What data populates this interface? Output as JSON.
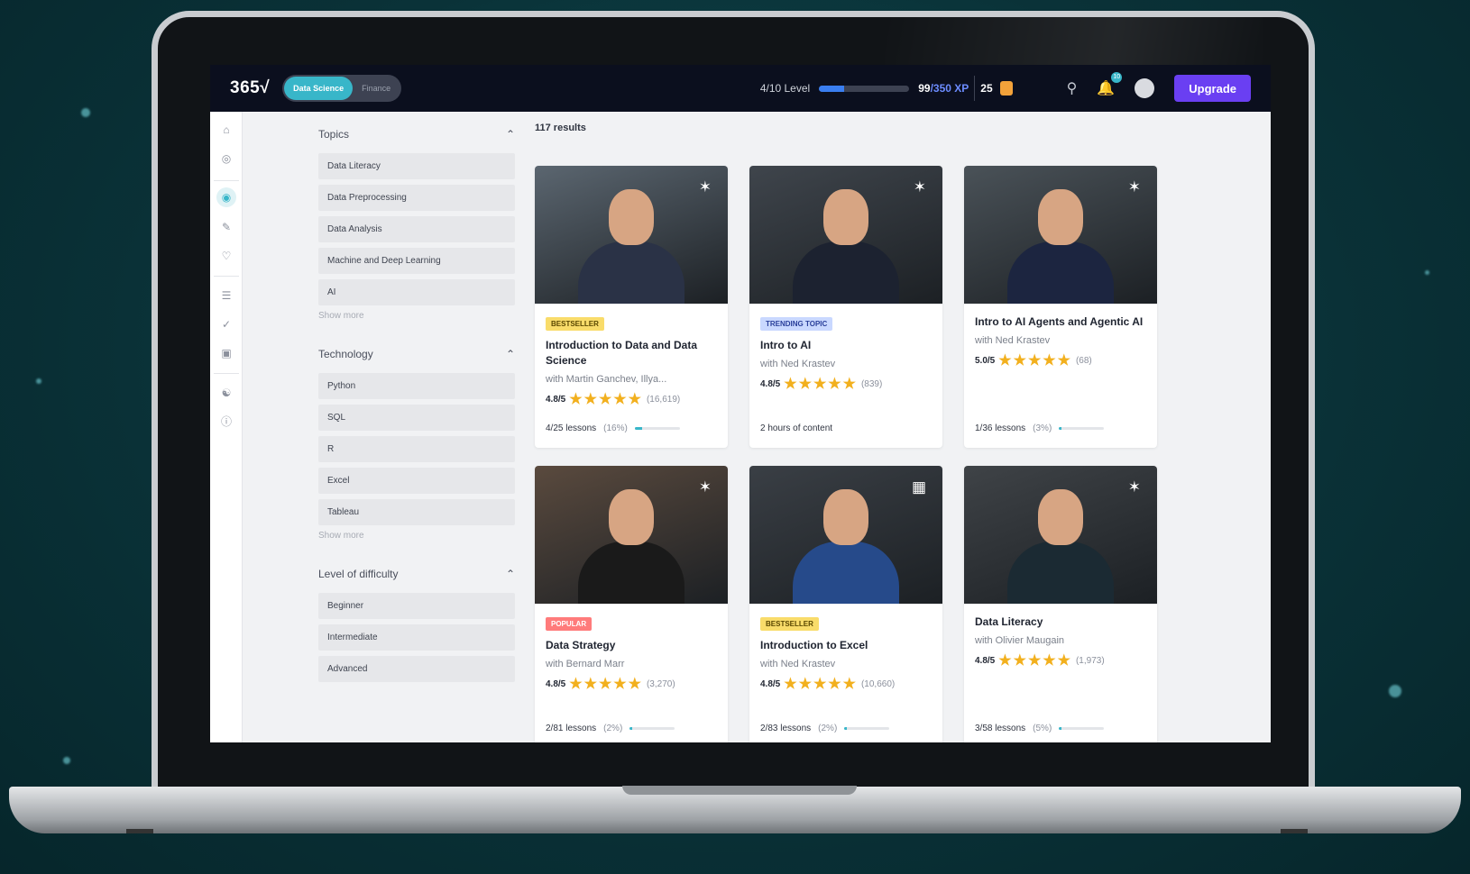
{
  "topbar": {
    "logo": "365√",
    "segments": [
      "Data Science",
      "Finance"
    ],
    "level_label": "4/10 Level",
    "level_fraction": 0.28,
    "xp_current": "99",
    "xp_rest": "/350 XP",
    "coins": "25",
    "notifications": "10",
    "upgrade": "Upgrade"
  },
  "filters": {
    "topics": {
      "title": "Topics",
      "items": [
        "Data Literacy",
        "Data Preprocessing",
        "Data Analysis",
        "Machine and Deep Learning",
        "AI"
      ],
      "show_more": "Show more"
    },
    "technology": {
      "title": "Technology",
      "items": [
        "Python",
        "SQL",
        "R",
        "Excel",
        "Tableau"
      ],
      "show_more": "Show more"
    },
    "difficulty": {
      "title": "Level of difficulty",
      "items": [
        "Beginner",
        "Intermediate",
        "Advanced"
      ]
    }
  },
  "results_count": "117 results",
  "cards": [
    {
      "badge": "BESTSELLER",
      "badge_kind": "bestseller",
      "title": "Introduction to Data and Data Science",
      "author": "with Martin Ganchev, Illya...",
      "rating": "4.8/5",
      "count": "(16,619)",
      "progress": "4/25 lessons",
      "pct": "(16%)",
      "pct_value": 0.16,
      "icon": "network-icon",
      "bg": "#5b6670",
      "shirt": "#2a3246"
    },
    {
      "badge": "TRENDING TOPIC",
      "badge_kind": "trending",
      "title": "Intro to AI",
      "author": "with Ned Krastev",
      "rating": "4.8/5",
      "count": "(839)",
      "progress": "2 hours of content",
      "pct": "",
      "pct_value": null,
      "icon": "network-icon",
      "bg": "#3f454c",
      "shirt": "#1c2230"
    },
    {
      "badge": "",
      "badge_kind": "",
      "title": "Intro to AI Agents and Agentic AI",
      "author": "with Ned Krastev",
      "rating": "5.0/5",
      "count": "(68)",
      "progress": "1/36 lessons",
      "pct": "(3%)",
      "pct_value": 0.03,
      "icon": "network-icon",
      "bg": "#4a5258",
      "shirt": "#1c2540"
    },
    {
      "badge": "POPULAR",
      "badge_kind": "popular",
      "title": "Data Strategy",
      "author": "with Bernard Marr",
      "rating": "4.8/5",
      "count": "(3,270)",
      "progress": "2/81 lessons",
      "pct": "(2%)",
      "pct_value": 0.02,
      "icon": "network-icon",
      "bg": "#5a4a3e",
      "shirt": "#1a1a1a"
    },
    {
      "badge": "BESTSELLER",
      "badge_kind": "bestseller",
      "title": "Introduction to Excel",
      "author": "with Ned Krastev",
      "rating": "4.8/5",
      "count": "(10,660)",
      "progress": "2/83 lessons",
      "pct": "(2%)",
      "pct_value": 0.02,
      "icon": "excel-icon",
      "bg": "#3a3f45",
      "shirt": "#264a8a"
    },
    {
      "badge": "",
      "badge_kind": "",
      "title": "Data Literacy",
      "author": "with Olivier Maugain",
      "rating": "4.8/5",
      "count": "(1,973)",
      "progress": "3/58 lessons",
      "pct": "(5%)",
      "pct_value": 0.05,
      "icon": "network-icon",
      "bg": "#3f4347",
      "shirt": "#1b2a33"
    }
  ]
}
